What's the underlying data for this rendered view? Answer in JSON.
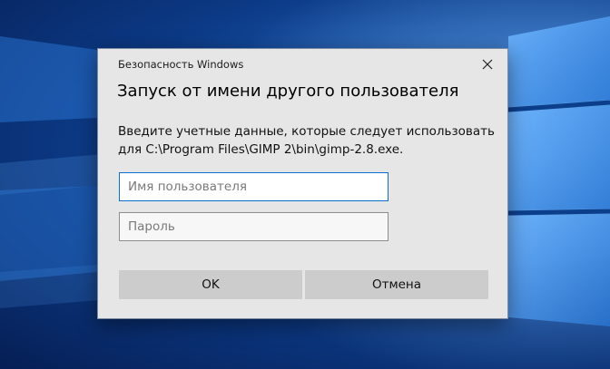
{
  "dialog": {
    "caption": "Безопасность Windows",
    "title": "Запуск от имени другого пользователя",
    "instruction_line1": "Введите учетные данные, которые следует использовать",
    "instruction_line2": "для C:\\Program Files\\GIMP 2\\bin\\gimp-2.8.exe.",
    "username": {
      "value": "",
      "placeholder": "Имя пользователя"
    },
    "password": {
      "value": "",
      "placeholder": "Пароль"
    },
    "ok_label": "OK",
    "cancel_label": "Отмена",
    "close_icon": "close-icon"
  },
  "colors": {
    "dialog_background": "#e6e6e6",
    "button_background": "#cccccc",
    "focus_border": "#0a6fcf",
    "desktop_blue": "#1d5fb8"
  }
}
